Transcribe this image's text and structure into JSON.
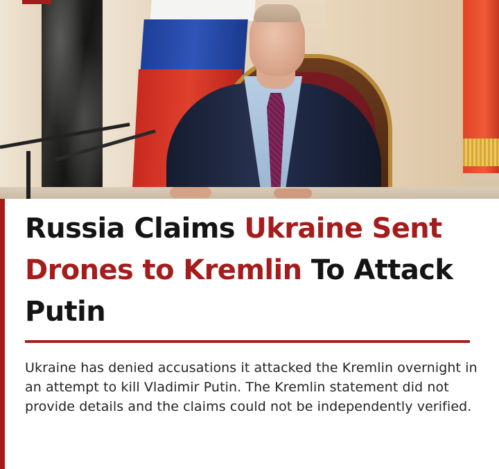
{
  "article": {
    "headline": {
      "part1": "Russia Claims ",
      "part2": "Ukraine Sent Drones to Kremlin",
      "part3": " To Attack Putin"
    },
    "summary": "Ukraine has denied accusations it attacked the Kremlin overnight in an attempt to kill Vladimir Putin. The Kremlin statement did not provide details and the claims could not be independently verified."
  },
  "colors": {
    "accent": "#a81b1b",
    "text": "#141414",
    "body_text": "#222222",
    "background": "#ffffff"
  }
}
